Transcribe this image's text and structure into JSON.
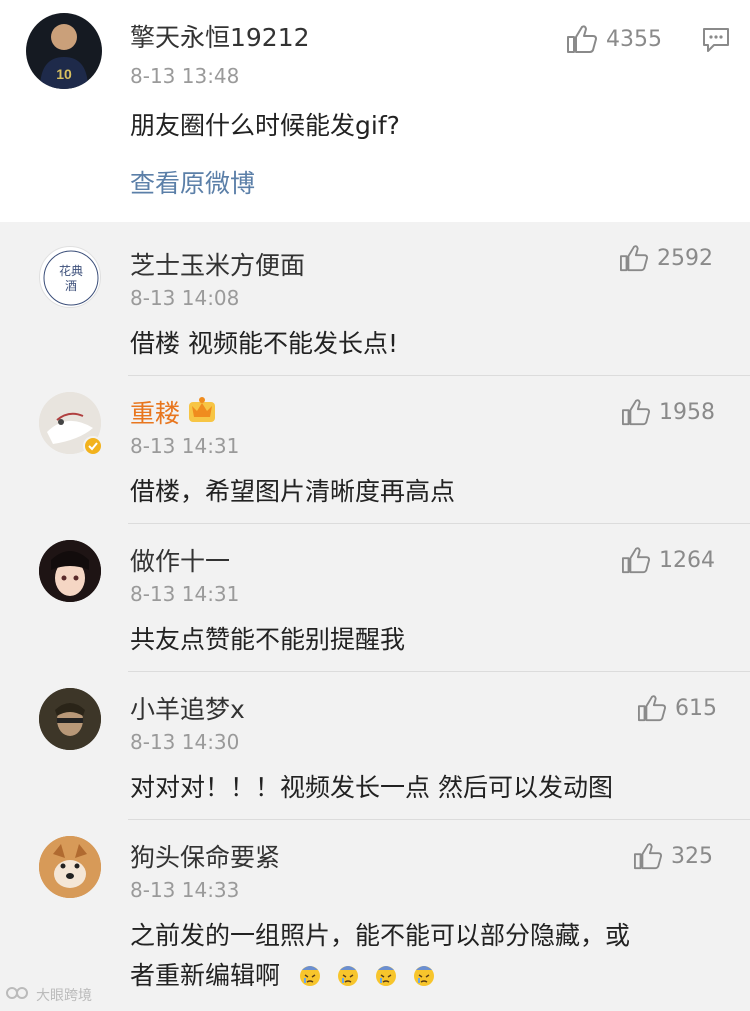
{
  "main": {
    "username": "擎天永恒19212",
    "time": "8-13 13:48",
    "text": "朋友圈什么时候能发gif?",
    "likes": "4355",
    "view_original": "查看原微博"
  },
  "replies": [
    {
      "username": "芝士玉米方便面",
      "time": "8-13 14:08",
      "text": "借楼 视频能不能发长点!",
      "likes": "2592"
    },
    {
      "username": "重耧",
      "time": "8-13 14:31",
      "text": "借楼，希望图片清晰度再高点",
      "likes": "1958",
      "name_color": "#e8761e",
      "badge": "crown-icon"
    },
    {
      "username": "做作十一",
      "time": "8-13 14:31",
      "text": "共友点赞能不能别提醒我",
      "likes": "1264"
    },
    {
      "username": "小羊追梦x",
      "time": "8-13 14:30",
      "text": "对对对！！！视频发长一点  然后可以发动图",
      "likes": "615"
    },
    {
      "username": "狗头保命要紧",
      "time": "8-13 14:33",
      "text_line1": "之前发的一组照片，能不能可以部分隐藏，或",
      "text_line2": "者重新编辑啊",
      "likes": "325"
    }
  ],
  "watermark": "大眼跨境",
  "colors": {
    "link": "#5b7fa8",
    "vip_name": "#e8761e",
    "reply_bg": "#f2f2f2"
  }
}
